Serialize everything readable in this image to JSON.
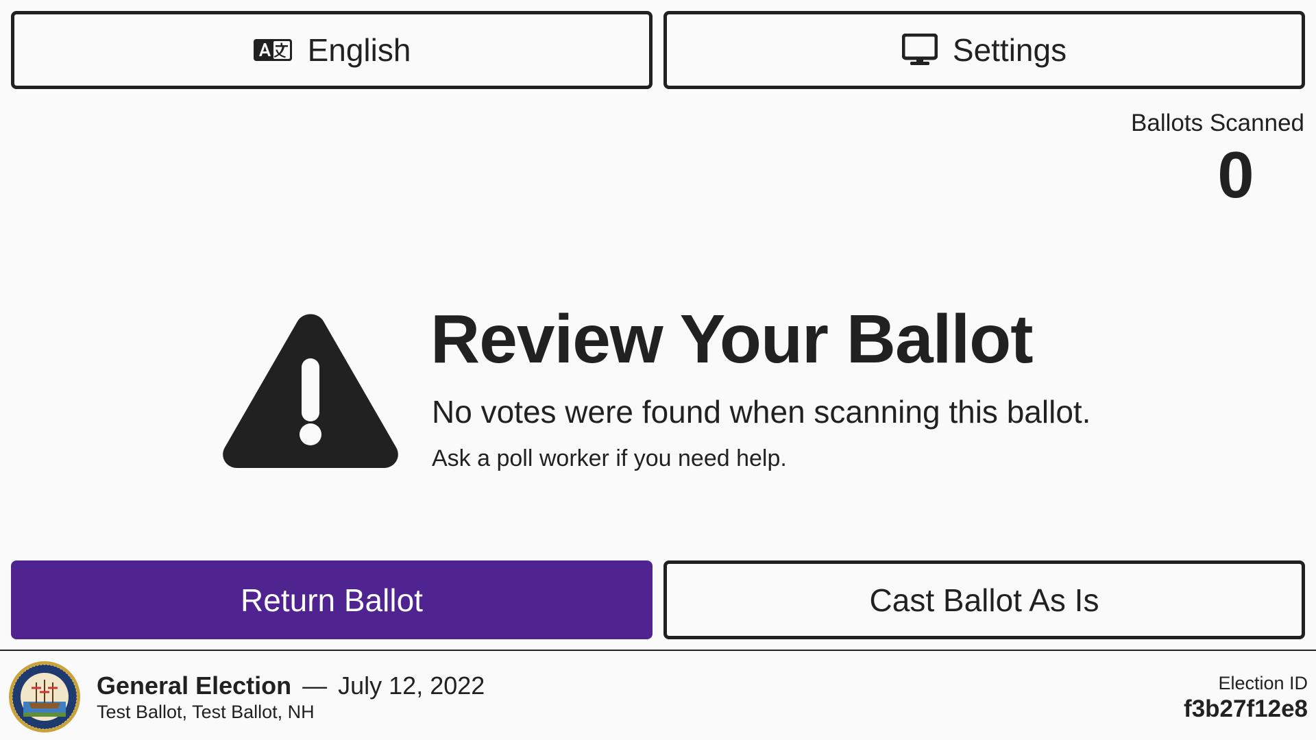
{
  "header": {
    "language_label": "English",
    "settings_label": "Settings"
  },
  "status": {
    "ballots_scanned_label": "Ballots Scanned",
    "ballots_scanned_count": "0"
  },
  "message": {
    "title": "Review Your Ballot",
    "subtitle": "No votes were found when scanning this ballot.",
    "help": "Ask a poll worker if you need help."
  },
  "actions": {
    "return_label": "Return Ballot",
    "cast_label": "Cast Ballot As Is"
  },
  "footer": {
    "election_name": "General Election",
    "separator": "—",
    "election_date": "July 12, 2022",
    "ballot_info": "Test Ballot, Test Ballot, NH",
    "election_id_label": "Election ID",
    "election_id": "f3b27f12e8"
  },
  "colors": {
    "primary": "#4f2390",
    "text": "#212121",
    "background": "#fafafa"
  },
  "icons": {
    "language": "translate-icon",
    "settings": "display-icon",
    "warning": "warning-triangle-icon",
    "seal": "state-seal"
  }
}
